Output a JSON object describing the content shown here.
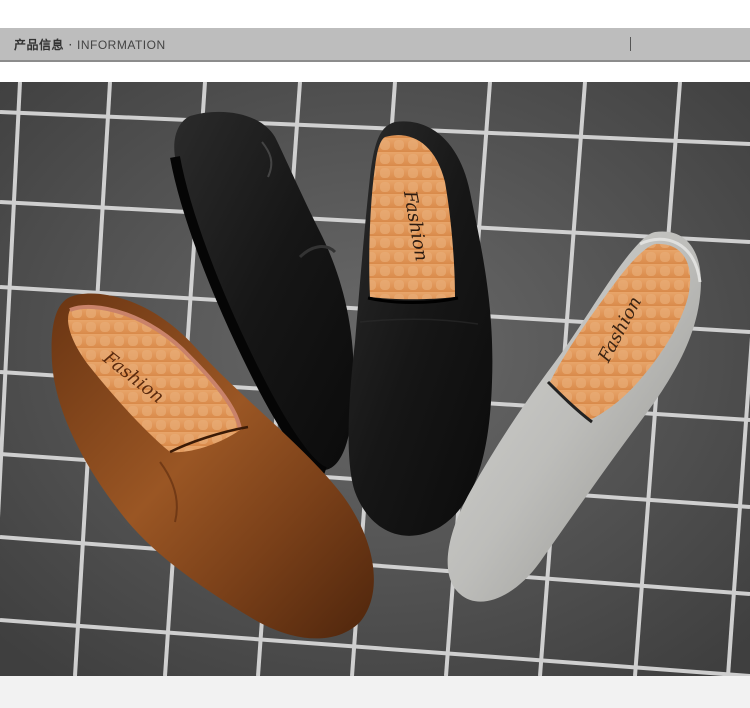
{
  "header": {
    "title_cn": "产品信息",
    "separator": "·",
    "title_en": "INFORMATION"
  },
  "photo": {
    "subject": "three slip-on leather loafers on grid surface",
    "shoes": [
      {
        "color_name": "brown",
        "insole_text": "Fashion",
        "color": "#8a4a1e"
      },
      {
        "color_name": "black",
        "insole_text": "",
        "color": "#1c1c1c"
      },
      {
        "color_name": "black",
        "insole_text": "Fashion",
        "color": "#1a1a1a"
      },
      {
        "color_name": "grey",
        "insole_text": "Fashion",
        "color": "#b9b9b6"
      }
    ],
    "background_color": "#5b5b5b",
    "grid_line_color": "#dcdcdc"
  }
}
